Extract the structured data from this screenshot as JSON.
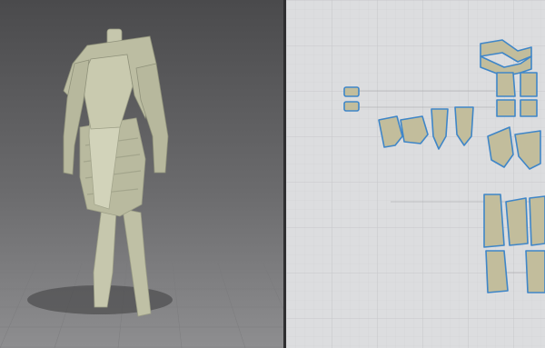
{
  "app": {
    "panels": [
      "3d-garment-viewport",
      "2d-pattern-window"
    ],
    "colors": {
      "viewport_bg_top": "#4a4a4c",
      "viewport_bg_bottom": "#8e8e90",
      "fabric": "#c6c7ad",
      "fabric_shadow": "#a3a58c",
      "pattern_bg": "#dcdddf",
      "pattern_fill": "#c2bd9c",
      "pattern_outline": "#3f86c8"
    },
    "toolbar_icon": "tool-icon"
  }
}
